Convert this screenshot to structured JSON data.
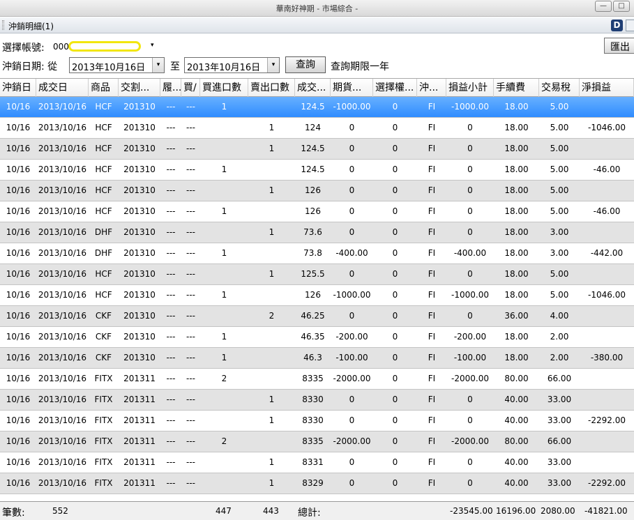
{
  "window": {
    "title": "華南好神期 - 市場綜合 -",
    "minimize": "—",
    "maximize": "□"
  },
  "panel": {
    "title": "沖銷明細(1)",
    "dock_icon_letter": "D"
  },
  "form": {
    "account_label": "選擇帳號:",
    "account_value": "000-",
    "date_label": "沖銷日期: 從",
    "date_from": "2013年10月16日",
    "to_label": "至",
    "date_to": "2013年10月16日",
    "query_button": "查詢",
    "query_note": "查詢期限一年",
    "export_button": "匯出",
    "dropdown_glyph": "▾"
  },
  "columns": [
    "沖銷日",
    "成交日",
    "商品",
    "交割...",
    "履...",
    "買/",
    "買進口數",
    "賣出口數",
    "成交...",
    "期貨...",
    "選擇權...",
    "沖...",
    "損益小計",
    "手續費",
    "交易稅",
    "淨損益"
  ],
  "rows": [
    [
      "10/16",
      "2013/10/16",
      "HCF",
      "201310",
      "---",
      "---",
      "1",
      "",
      "124.5",
      "-1000.00",
      "0",
      "FI",
      "-1000.00",
      "18.00",
      "5.00",
      ""
    ],
    [
      "10/16",
      "2013/10/16",
      "HCF",
      "201310",
      "---",
      "---",
      "",
      "1",
      "124",
      "0",
      "0",
      "FI",
      "0",
      "18.00",
      "5.00",
      "-1046.00"
    ],
    [
      "10/16",
      "2013/10/16",
      "HCF",
      "201310",
      "---",
      "---",
      "",
      "1",
      "124.5",
      "0",
      "0",
      "FI",
      "0",
      "18.00",
      "5.00",
      ""
    ],
    [
      "10/16",
      "2013/10/16",
      "HCF",
      "201310",
      "---",
      "---",
      "1",
      "",
      "124.5",
      "0",
      "0",
      "FI",
      "0",
      "18.00",
      "5.00",
      "-46.00"
    ],
    [
      "10/16",
      "2013/10/16",
      "HCF",
      "201310",
      "---",
      "---",
      "",
      "1",
      "126",
      "0",
      "0",
      "FI",
      "0",
      "18.00",
      "5.00",
      ""
    ],
    [
      "10/16",
      "2013/10/16",
      "HCF",
      "201310",
      "---",
      "---",
      "1",
      "",
      "126",
      "0",
      "0",
      "FI",
      "0",
      "18.00",
      "5.00",
      "-46.00"
    ],
    [
      "10/16",
      "2013/10/16",
      "DHF",
      "201310",
      "---",
      "---",
      "",
      "1",
      "73.6",
      "0",
      "0",
      "FI",
      "0",
      "18.00",
      "3.00",
      ""
    ],
    [
      "10/16",
      "2013/10/16",
      "DHF",
      "201310",
      "---",
      "---",
      "1",
      "",
      "73.8",
      "-400.00",
      "0",
      "FI",
      "-400.00",
      "18.00",
      "3.00",
      "-442.00"
    ],
    [
      "10/16",
      "2013/10/16",
      "HCF",
      "201310",
      "---",
      "---",
      "",
      "1",
      "125.5",
      "0",
      "0",
      "FI",
      "0",
      "18.00",
      "5.00",
      ""
    ],
    [
      "10/16",
      "2013/10/16",
      "HCF",
      "201310",
      "---",
      "---",
      "1",
      "",
      "126",
      "-1000.00",
      "0",
      "FI",
      "-1000.00",
      "18.00",
      "5.00",
      "-1046.00"
    ],
    [
      "10/16",
      "2013/10/16",
      "CKF",
      "201310",
      "---",
      "---",
      "",
      "2",
      "46.25",
      "0",
      "0",
      "FI",
      "0",
      "36.00",
      "4.00",
      ""
    ],
    [
      "10/16",
      "2013/10/16",
      "CKF",
      "201310",
      "---",
      "---",
      "1",
      "",
      "46.35",
      "-200.00",
      "0",
      "FI",
      "-200.00",
      "18.00",
      "2.00",
      ""
    ],
    [
      "10/16",
      "2013/10/16",
      "CKF",
      "201310",
      "---",
      "---",
      "1",
      "",
      "46.3",
      "-100.00",
      "0",
      "FI",
      "-100.00",
      "18.00",
      "2.00",
      "-380.00"
    ],
    [
      "10/16",
      "2013/10/16",
      "FITX",
      "201311",
      "---",
      "---",
      "2",
      "",
      "8335",
      "-2000.00",
      "0",
      "FI",
      "-2000.00",
      "80.00",
      "66.00",
      ""
    ],
    [
      "10/16",
      "2013/10/16",
      "FITX",
      "201311",
      "---",
      "---",
      "",
      "1",
      "8330",
      "0",
      "0",
      "FI",
      "0",
      "40.00",
      "33.00",
      ""
    ],
    [
      "10/16",
      "2013/10/16",
      "FITX",
      "201311",
      "---",
      "---",
      "",
      "1",
      "8330",
      "0",
      "0",
      "FI",
      "0",
      "40.00",
      "33.00",
      "-2292.00"
    ],
    [
      "10/16",
      "2013/10/16",
      "FITX",
      "201311",
      "---",
      "---",
      "2",
      "",
      "8335",
      "-2000.00",
      "0",
      "FI",
      "-2000.00",
      "80.00",
      "66.00",
      ""
    ],
    [
      "10/16",
      "2013/10/16",
      "FITX",
      "201311",
      "---",
      "---",
      "",
      "1",
      "8331",
      "0",
      "0",
      "FI",
      "0",
      "40.00",
      "33.00",
      ""
    ],
    [
      "10/16",
      "2013/10/16",
      "FITX",
      "201311",
      "---",
      "---",
      "",
      "1",
      "8329",
      "0",
      "0",
      "FI",
      "0",
      "40.00",
      "33.00",
      "-2292.00"
    ]
  ],
  "selected_row": 0,
  "footer": {
    "count_label": "筆數:",
    "count": "552",
    "buy_total": "447",
    "sell_total": "443",
    "total_label": "總計:",
    "pnl_total": "-23545.00",
    "fee_total": "16196.00",
    "tax_total": "2080.00",
    "net_total": "-41821.00"
  }
}
